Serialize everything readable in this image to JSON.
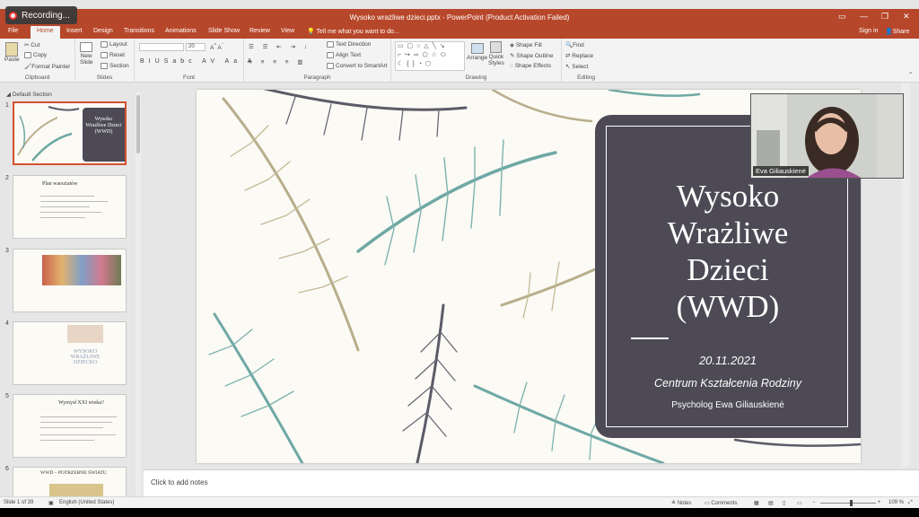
{
  "recording": {
    "label": "Recording..."
  },
  "window": {
    "title": "Wysoko wrażliwe dzieci.pptx - PowerPoint (Product Activation Failed)"
  },
  "account": {
    "sign_in": "Sign in",
    "share": "Share"
  },
  "tabs": [
    "File",
    "Home",
    "Insert",
    "Design",
    "Transitions",
    "Animations",
    "Slide Show",
    "Review",
    "View"
  ],
  "tell_me": "Tell me what you want to do...",
  "ribbon": {
    "clipboard": {
      "label": "Clipboard",
      "paste": "Paste",
      "cut": "Cut",
      "copy": "Copy",
      "format_painter": "Format Painter"
    },
    "slides": {
      "label": "Slides",
      "new_slide": "New",
      "new_slide2": "Slide",
      "layout": "Layout",
      "reset": "Reset",
      "section": "Section"
    },
    "font": {
      "label": "Font",
      "size": "20"
    },
    "paragraph": {
      "label": "Paragraph",
      "text_direction": "Text Direction",
      "align_text": "Align Text",
      "convert": "Convert to SmartArt"
    },
    "drawing": {
      "label": "Drawing",
      "arrange": "Arrange",
      "quick_styles": "Quick",
      "quick_styles2": "Styles",
      "shape_fill": "Shape Fill",
      "shape_outline": "Shape Outline",
      "shape_effects": "Shape Effects"
    },
    "editing": {
      "label": "Editing",
      "find": "Find",
      "replace": "Replace",
      "select": "Select"
    }
  },
  "thumbnails": {
    "section": "Default Section",
    "slides": [
      {
        "num": "1",
        "title": "Wysoko Wrażliwe Dzieci (WWD)"
      },
      {
        "num": "2",
        "title": "Plan warsztatów"
      },
      {
        "num": "3",
        "title": ""
      },
      {
        "num": "4",
        "title": "WYSOKO WRAŻLIWE DZIECKO"
      },
      {
        "num": "5",
        "title": "Wymysł XXI wieku?"
      },
      {
        "num": "6",
        "title": "WWD – POTRZEBNE ŚWIATU"
      }
    ]
  },
  "slide": {
    "title_lines": [
      "Wysoko",
      "Wrażliwe",
      "Dzieci",
      "(WWD)"
    ],
    "date": "20.11.2021",
    "organization": "Centrum Kształcenia Rodziny",
    "author": "Psycholog Ewa Giliauskienė"
  },
  "video": {
    "name": "Eva Giliauskienė"
  },
  "notes": {
    "placeholder": "Click to add notes"
  },
  "status": {
    "slide_counter": "Slide 1 of 39",
    "language": "English (United States)",
    "notes": "Notes",
    "comments": "Comments",
    "zoom": "109 %"
  },
  "colors": {
    "accent": "#b7472a",
    "title_box": "#4d4a55",
    "feather_teal": "#6fa8a4",
    "feather_khaki": "#b8ae8b",
    "feather_slate": "#5d5a68"
  }
}
